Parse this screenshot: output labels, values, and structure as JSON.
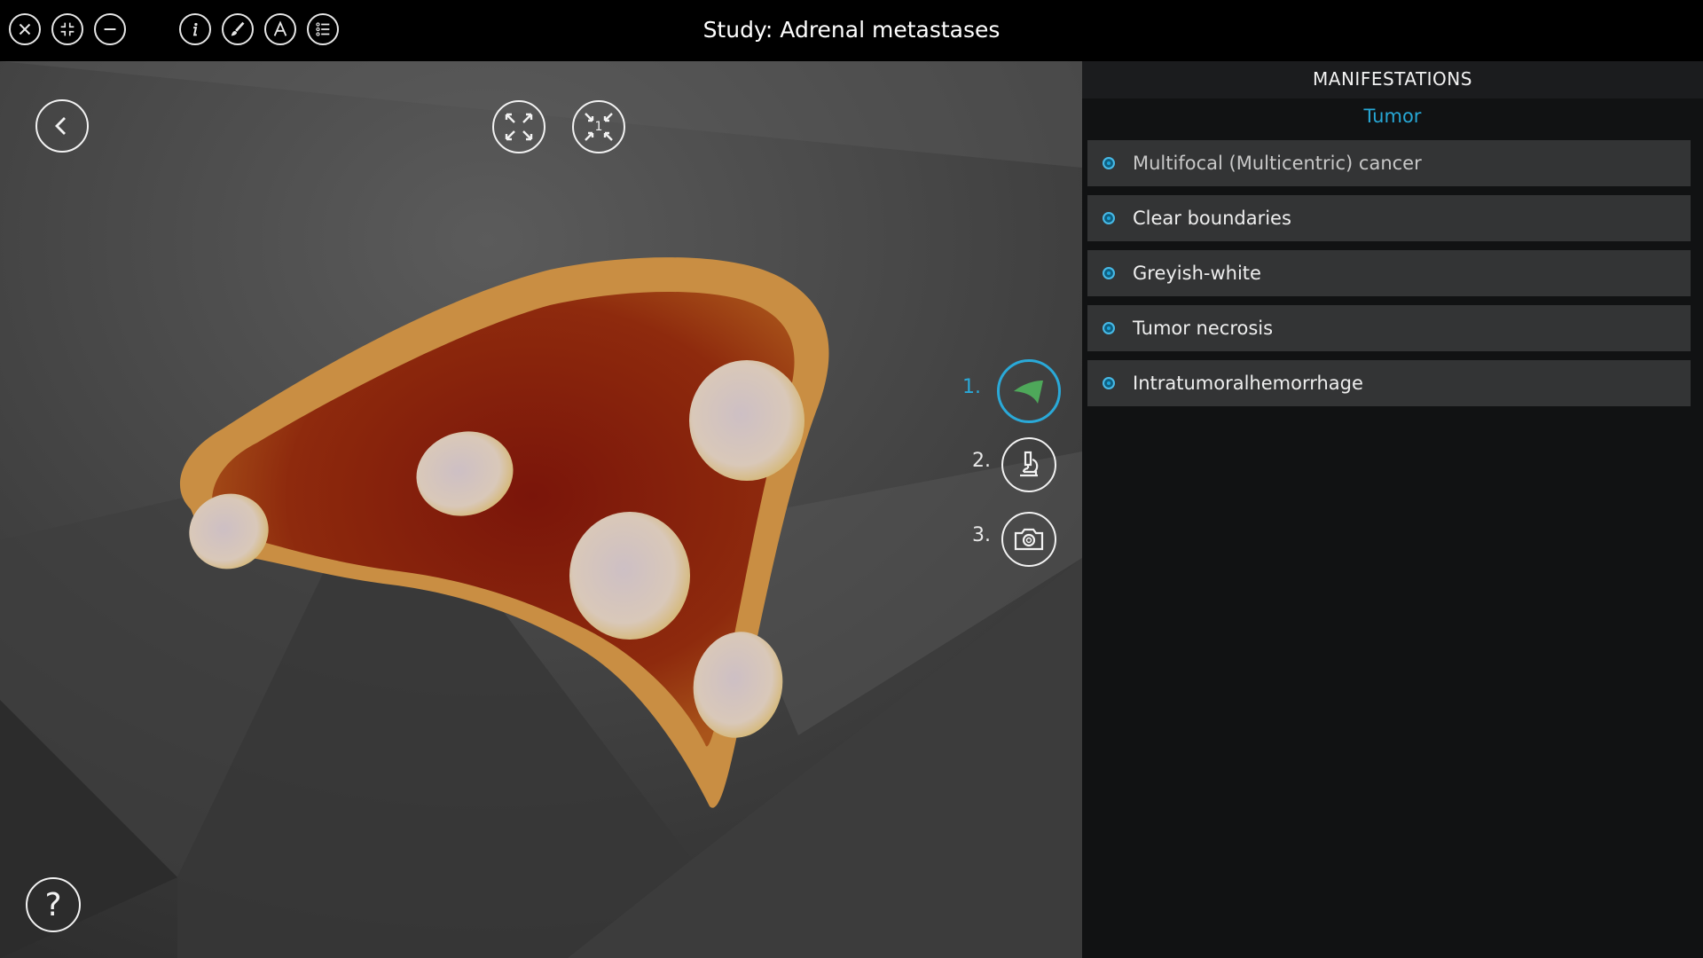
{
  "app": {
    "title": "Study: Adrenal metastases"
  },
  "toolbar": {
    "buttons": [
      {
        "name": "close-icon"
      },
      {
        "name": "restore-window-icon"
      },
      {
        "name": "minimize-icon"
      },
      {
        "name": "info-icon"
      },
      {
        "name": "brush-icon"
      },
      {
        "name": "annotation-icon"
      },
      {
        "name": "list-icon"
      }
    ]
  },
  "viewer": {
    "zoom_fit_badge": "1",
    "steps": [
      {
        "number": "1.",
        "icon": "organ-icon",
        "active": true
      },
      {
        "number": "2.",
        "icon": "microscope-icon",
        "active": false
      },
      {
        "number": "3.",
        "icon": "camera-icon",
        "active": false
      }
    ],
    "help_label": "?"
  },
  "panel": {
    "header": "MANIFESTATIONS",
    "subheader": "Tumor",
    "items": [
      {
        "label": "Multifocal (Multicentric) cancer"
      },
      {
        "label": "Clear boundaries"
      },
      {
        "label": "Greyish-white"
      },
      {
        "label": "Tumor necrosis"
      },
      {
        "label": "Intratumoralhemorrhage"
      }
    ]
  },
  "colors": {
    "accent": "#27a8d6",
    "panel_bg": "#111213",
    "item_bg": "#333435",
    "organ_fill": "#8a1e0c"
  }
}
